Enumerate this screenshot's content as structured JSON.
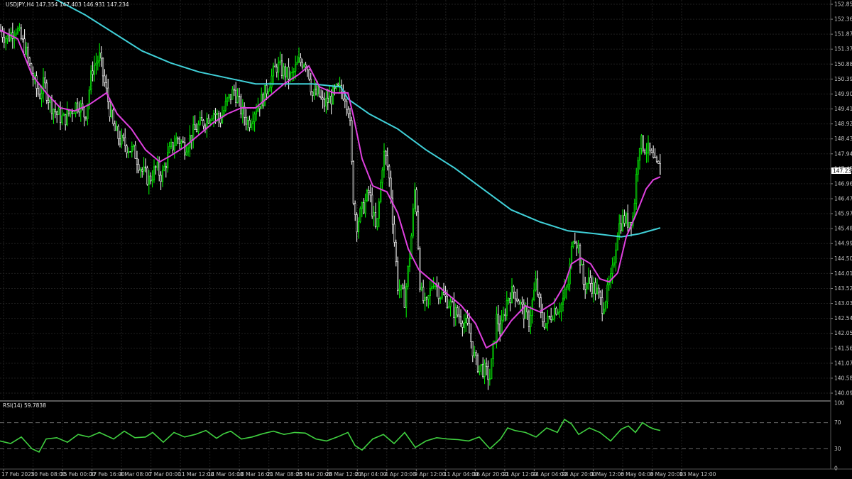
{
  "header": {
    "symbol_info": "USDJPY,H4  147.354 147.403 146.931 147.234"
  },
  "rsi_header": "RSI(14) 59.7838",
  "price_tag": "147.234",
  "colors": {
    "background": "#000000",
    "grid": "#1f1f1f",
    "bull": "#00ff00",
    "bear": "#ffffff",
    "ma_fast": "#e040e0",
    "ma_slow": "#40d0d8",
    "rsi": "#40d040",
    "separator": "#5a5a5a"
  },
  "chart_data": [
    {
      "type": "line",
      "title": "",
      "panel": "price",
      "ylim": [
        139.6,
        152.85
      ],
      "yticks": [
        "152.850",
        "152.360",
        "151.870",
        "151.370",
        "150.880",
        "150.390",
        "149.900",
        "149.410",
        "148.920",
        "148.430",
        "147.940",
        "147.450",
        "146.960",
        "146.470",
        "145.970",
        "145.480",
        "144.990",
        "144.500",
        "144.010",
        "143.520",
        "143.030",
        "142.540",
        "142.050",
        "141.560",
        "141.070",
        "140.580",
        "140.090"
      ],
      "xticks": [
        "17 Feb 2025",
        "20 Feb 08:00",
        "25 Feb 00:00",
        "27 Feb 16:00",
        "4 Mar 08:00",
        "7 Mar 00:00",
        "11 Mar 12:00",
        "14 Mar 04:00",
        "18 Mar 16:00",
        "21 Mar 08:00",
        "25 Mar 20:00",
        "28 Mar 12:00",
        "2 Apr 04:00",
        "4 Apr 20:00",
        "9 Apr 12:00",
        "11 Apr 04:00",
        "16 Apr 20:00",
        "21 Apr 12:00",
        "24 Apr 04:00",
        "28 Apr 20:00",
        "1 May 12:00",
        "6 May 04:00",
        "8 May 20:00",
        "13 May 12:00"
      ],
      "grid": true,
      "series": [
        {
          "kind": "close",
          "x": [
            0,
            10,
            22,
            35,
            45,
            55,
            62,
            70,
            80,
            90,
            100,
            110,
            120,
            130,
            140,
            150,
            160,
            170,
            180,
            190,
            200,
            210,
            220,
            228,
            235,
            240,
            250,
            260,
            270,
            280,
            290,
            300,
            310,
            320,
            330,
            340,
            350,
            360,
            370,
            380,
            390,
            400,
            410,
            420,
            430,
            435,
            440,
            448,
            455,
            465,
            475,
            485,
            492,
            497,
            502,
            510,
            520,
            530,
            540,
            545,
            550,
            560,
            570,
            578,
            585,
            592,
            600,
            610,
            620,
            630,
            640,
            650,
            660,
            670,
            680,
            690,
            695,
            700,
            705,
            715,
            725,
            735,
            745,
            755,
            762,
            770,
            780,
            790,
            800,
            808,
            815,
            822,
            830,
            840,
            848,
            855,
            862,
            870,
            878,
            885,
            892,
            900,
            908,
            915,
            922,
            930
          ],
          "y": [
            151.9,
            151.6,
            152.0,
            151.3,
            150.4,
            149.7,
            150.1,
            149.5,
            149.1,
            148.9,
            149.2,
            149.5,
            149.0,
            150.6,
            151.0,
            149.8,
            148.6,
            148.2,
            148.0,
            147.8,
            147.2,
            146.9,
            147.3,
            147.0,
            147.6,
            147.9,
            148.3,
            148.0,
            148.4,
            148.7,
            148.9,
            149.2,
            148.9,
            149.5,
            149.9,
            149.2,
            148.8,
            149.3,
            149.6,
            150.2,
            150.7,
            150.5,
            150.3,
            150.8,
            150.9,
            150.5,
            149.7,
            149.8,
            149.4,
            149.6,
            149.9,
            149.8,
            149.2,
            146.5,
            145.4,
            145.9,
            146.5,
            145.1,
            147.8,
            147.5,
            146.6,
            143.4,
            142.9,
            144.6,
            146.8,
            143.2,
            142.6,
            143.6,
            143.1,
            142.9,
            142.5,
            142.3,
            141.9,
            140.8,
            140.6,
            140.3,
            141.3,
            142.4,
            141.8,
            143.0,
            143.2,
            142.6,
            142.2,
            143.5,
            142.3,
            142.1,
            142.6,
            142.7,
            143.4,
            145.2,
            144.6,
            143.4,
            143.5,
            143.2,
            142.7,
            143.1,
            143.7,
            145.3,
            145.6,
            145.5,
            145.7,
            148.2,
            148.0,
            147.8,
            147.4,
            147.234
          ]
        },
        {
          "kind": "ma_fast",
          "x": [
            0,
            25,
            45,
            65,
            85,
            105,
            125,
            150,
            165,
            185,
            205,
            225,
            240,
            260,
            280,
            300,
            320,
            340,
            360,
            380,
            400,
            420,
            435,
            450,
            470,
            490,
            498,
            510,
            525,
            545,
            560,
            575,
            590,
            610,
            630,
            650,
            670,
            685,
            700,
            720,
            740,
            760,
            780,
            795,
            805,
            818,
            832,
            845,
            858,
            870,
            882,
            895,
            910,
            920,
            930
          ],
          "y": [
            151.9,
            151.6,
            150.4,
            149.8,
            149.3,
            149.2,
            149.4,
            149.8,
            149.1,
            148.6,
            147.9,
            147.5,
            147.7,
            148.0,
            148.4,
            148.8,
            149.1,
            149.3,
            149.3,
            149.7,
            150.1,
            150.4,
            150.7,
            150.0,
            149.8,
            149.8,
            149.0,
            147.6,
            146.7,
            146.5,
            145.8,
            144.6,
            143.9,
            143.5,
            143.1,
            142.7,
            142.1,
            141.3,
            141.5,
            142.2,
            142.7,
            142.5,
            142.8,
            143.4,
            144.1,
            144.3,
            144.1,
            143.6,
            143.5,
            143.8,
            145.0,
            145.7,
            146.6,
            146.9,
            147.0
          ]
        },
        {
          "kind": "ma_slow",
          "x": [
            0,
            40,
            80,
            120,
            160,
            200,
            240,
            280,
            320,
            360,
            400,
            440,
            480,
            490,
            520,
            560,
            600,
            640,
            680,
            720,
            760,
            800,
            840,
            875,
            900,
            930
          ],
          "y": [
            153.4,
            153.2,
            152.9,
            152.4,
            151.8,
            151.2,
            150.8,
            150.5,
            150.3,
            150.1,
            150.1,
            150.1,
            150.0,
            149.6,
            149.1,
            148.6,
            147.9,
            147.3,
            146.6,
            145.9,
            145.5,
            145.2,
            145.1,
            145.0,
            145.1,
            145.3
          ]
        }
      ]
    },
    {
      "type": "line",
      "title": "",
      "panel": "rsi",
      "ylim": [
        0,
        100
      ],
      "yticks": [
        "100",
        "70",
        "30",
        "0"
      ],
      "levels": [
        70,
        30
      ],
      "grid": true,
      "series": [
        {
          "kind": "rsi",
          "x": [
            0,
            15,
            30,
            45,
            55,
            65,
            80,
            95,
            110,
            125,
            140,
            150,
            160,
            175,
            190,
            205,
            215,
            230,
            245,
            260,
            275,
            290,
            305,
            315,
            325,
            340,
            355,
            370,
            385,
            400,
            415,
            430,
            445,
            460,
            475,
            490,
            500,
            510,
            525,
            540,
            555,
            570,
            585,
            600,
            615,
            630,
            645,
            660,
            675,
            690,
            705,
            715,
            725,
            740,
            755,
            770,
            785,
            795,
            805,
            815,
            830,
            845,
            860,
            875,
            885,
            895,
            905,
            915,
            922,
            930
          ],
          "y": [
            42,
            38,
            48,
            30,
            25,
            45,
            47,
            40,
            52,
            48,
            55,
            50,
            45,
            57,
            47,
            48,
            55,
            40,
            55,
            48,
            52,
            58,
            46,
            53,
            57,
            45,
            48,
            53,
            57,
            52,
            55,
            54,
            45,
            42,
            48,
            55,
            35,
            28,
            45,
            52,
            38,
            55,
            32,
            42,
            47,
            45,
            44,
            42,
            48,
            30,
            45,
            62,
            58,
            55,
            48,
            62,
            55,
            75,
            68,
            52,
            62,
            55,
            42,
            60,
            65,
            55,
            70,
            63,
            60,
            58
          ]
        }
      ]
    }
  ]
}
